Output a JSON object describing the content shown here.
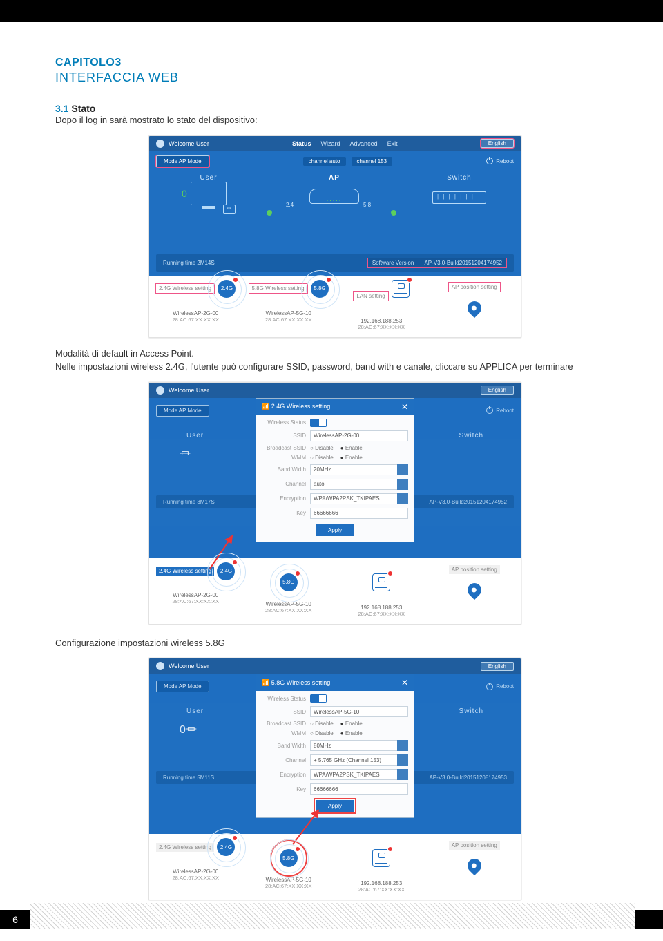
{
  "document": {
    "chapter_label": "CAPITOLO3",
    "chapter_subtitle": "INTERFACCIA WEB",
    "section_number": "3.1",
    "section_title": "Stato",
    "intro_text": "Dopo il log in sarà mostrato lo stato del dispositivo:",
    "para2_line1": "Modalità di default in Access Point.",
    "para2_line2": "Nelle impostazioni wireless 2.4G, l'utente può configurare SSID, password, band with e canale, cliccare su APPLICA per terminare",
    "para3": "Configurazione impostazioni wireless 5.8G",
    "page_number": "6"
  },
  "shot_status": {
    "welcome": "Welcome User",
    "nav": {
      "status": "Status",
      "wizard": "Wizard",
      "advanced": "Advanced",
      "exit": "Exit"
    },
    "lang": "English",
    "mode_label": "Mode AP Mode",
    "channel_auto": "channel auto",
    "channel_val": "channel 153",
    "reboot": "Reboot",
    "user_node": "User",
    "ap_node": "AP",
    "switch_node": "Switch",
    "band24": "2.4",
    "band58": "5.8",
    "client_count": "0",
    "running_time": "Running time 2M14S",
    "sw_label": "Software Version",
    "sw_value": "AP-V3.0-Build20151204174952",
    "cards": {
      "c1_tab": "2.4G Wireless setting",
      "c1_band": "2.4G",
      "c1_l1": "WirelessAP-2G-00",
      "c1_l2": "28:AC:67:XX:XX:XX",
      "c2_tab": "5.8G Wireless setting",
      "c2_band": "5.8G",
      "c2_l1": "WirelessAP-5G-10",
      "c2_l2": "28:AC:67:XX:XX:XX",
      "c3_tab": "LAN setting",
      "c3_l1": "192.168.188.253",
      "c3_l2": "28:AC:67:XX:XX:XX",
      "c4_tab": "AP position setting"
    }
  },
  "shot_modal_24": {
    "welcome": "Welcome User",
    "mode_label": "Mode AP Mode",
    "reboot": "Reboot",
    "running_time": "Running time 3M17S",
    "sw_value": "AP-V3.0-Build20151204174952",
    "modal_title": "2.4G Wireless setting",
    "fields": {
      "status": "Wireless Status",
      "ssid_label": "SSID",
      "ssid_value": "WirelessAP-2G-00",
      "broadcast": "Broadcast SSID",
      "opt_disable": "Disable",
      "opt_enable": "Enable",
      "wmm": "WMM",
      "bandwidth": "Band Width",
      "bandwidth_value": "20MHz",
      "channel": "Channel",
      "channel_value": "auto",
      "encryption": "Encryption",
      "encryption_value": "WPA/WPA2PSK_TKIPAES",
      "key": "Key",
      "key_value": "66666666",
      "apply": "Apply"
    },
    "cards": {
      "c1_tab": "2.4G Wireless setting",
      "c1_band": "2.4G",
      "c1_l1": "WirelessAP-2G-00",
      "c1_l2": "28:AC:67:XX:XX:XX",
      "c2_band": "5.8G",
      "c2_l1": "WirelessAP-5G-10",
      "c2_l2": "28:AC:67:XX:XX:XX",
      "c3_l1": "192.168.188.253",
      "c3_l2": "28:AC:67:XX:XX:XX"
    }
  },
  "shot_modal_58": {
    "welcome": "Welcome User",
    "mode_label": "Mode AP Mode",
    "reboot": "Reboot",
    "running_time": "Running time 5M11S",
    "sw_value": "AP-V3.0-Build20151208174953",
    "modal_title": "5.8G Wireless setting",
    "fields": {
      "status": "Wireless Status",
      "ssid_label": "SSID",
      "ssid_value": "WirelessAP-5G-10",
      "broadcast": "Broadcast SSID",
      "opt_disable": "Disable",
      "opt_enable": "Enable",
      "wmm": "WMM",
      "bandwidth": "Band Width",
      "bandwidth_value": "80MHz",
      "channel": "Channel",
      "channel_value": "+ 5.765 GHz (Channel 153)",
      "encryption": "Encryption",
      "encryption_value": "WPA/WPA2PSK_TKIPAES",
      "key": "Key",
      "key_value": "66666666",
      "apply": "Apply"
    },
    "cards": {
      "c1_tab": "2.4G Wireless setting",
      "c1_band": "2.4G",
      "c1_l1": "WirelessAP-2G-00",
      "c1_l2": "28:AC:67:XX:XX:XX",
      "c2_band": "5.8G",
      "c2_l1": "WirelessAP-5G-10",
      "c2_l2": "28:AC:67:XX:XX:XX",
      "c3_l1": "192.168.188.253",
      "c3_l2": "28:AC:67:XX:XX:XX",
      "c4_tab": "AP position setting"
    },
    "user_node": "User",
    "switch_node": "Switch"
  }
}
